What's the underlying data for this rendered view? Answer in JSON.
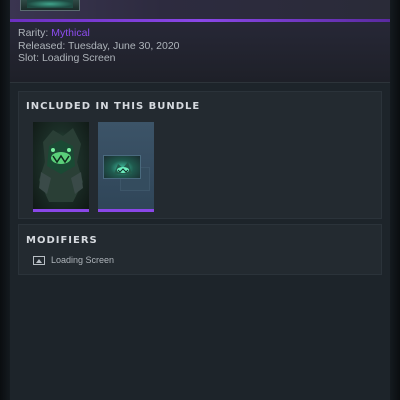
{
  "item": {
    "rarity_label": "Rarity:",
    "rarity_value": "Mythical",
    "released_label": "Released:",
    "released_value": "Tuesday, June 30, 2020",
    "slot_label": "Slot:",
    "slot_value": "Loading Screen"
  },
  "bundle": {
    "title": "INCLUDED IN THIS BUNDLE",
    "items": [
      {
        "icon": "mythical-hero-art-icon"
      },
      {
        "icon": "loading-screen-preview-icon"
      }
    ]
  },
  "modifiers": {
    "title": "MODIFIERS",
    "items": [
      {
        "icon": "image-icon",
        "label": "Loading Screen"
      }
    ]
  },
  "colors": {
    "accent_purple": "#8a47e8",
    "rarity_mythical": "#8d4cf0",
    "panel_bg": "#1d242a"
  }
}
